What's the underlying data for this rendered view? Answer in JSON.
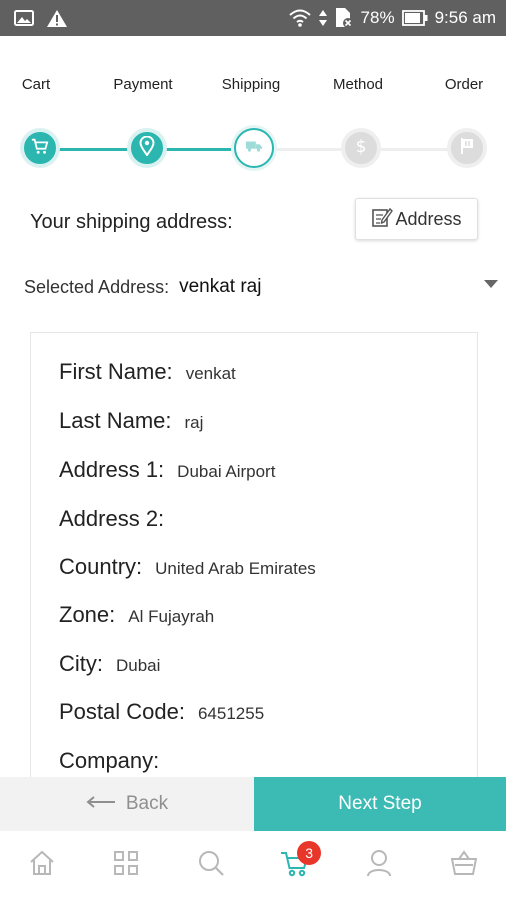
{
  "status_bar": {
    "battery": "78%",
    "time": "9:56 am"
  },
  "steps": [
    {
      "label": "Cart",
      "state": "done",
      "icon": "cart-icon"
    },
    {
      "label": "Payment",
      "state": "done",
      "icon": "location-pin-icon"
    },
    {
      "label": "Shipping",
      "state": "current",
      "icon": "truck-icon"
    },
    {
      "label": "Method",
      "state": "pending",
      "icon": "dollar-icon"
    },
    {
      "label": "Order",
      "state": "pending",
      "icon": "flag-icon"
    }
  ],
  "shipping": {
    "title": "Your shipping address:",
    "address_button": "Address"
  },
  "selected_address": {
    "label": "Selected Address:",
    "value": "venkat raj"
  },
  "address_card": {
    "fields": [
      {
        "label": "First Name:",
        "value": "venkat"
      },
      {
        "label": "Last Name:",
        "value": "raj"
      },
      {
        "label": "Address 1:",
        "value": "Dubai Airport"
      },
      {
        "label": "Address 2:",
        "value": ""
      },
      {
        "label": "Country:",
        "value": "United Arab Emirates"
      },
      {
        "label": "Zone:",
        "value": "Al Fujayrah"
      },
      {
        "label": "City:",
        "value": "Dubai"
      },
      {
        "label": "Postal Code:",
        "value": "6451255"
      },
      {
        "label": "Company:",
        "value": ""
      }
    ]
  },
  "actions": {
    "back_label": "Back",
    "next_label": "Next Step"
  },
  "tabbar": {
    "cart_badge": "3",
    "items": [
      "home-icon",
      "grid-icon",
      "search-icon",
      "cart-icon",
      "user-icon",
      "basket-icon"
    ]
  },
  "colors": {
    "accent": "#2bb6b0",
    "next_button": "#3cbab4",
    "badge": "#e8362b",
    "status_bar": "#606060"
  }
}
